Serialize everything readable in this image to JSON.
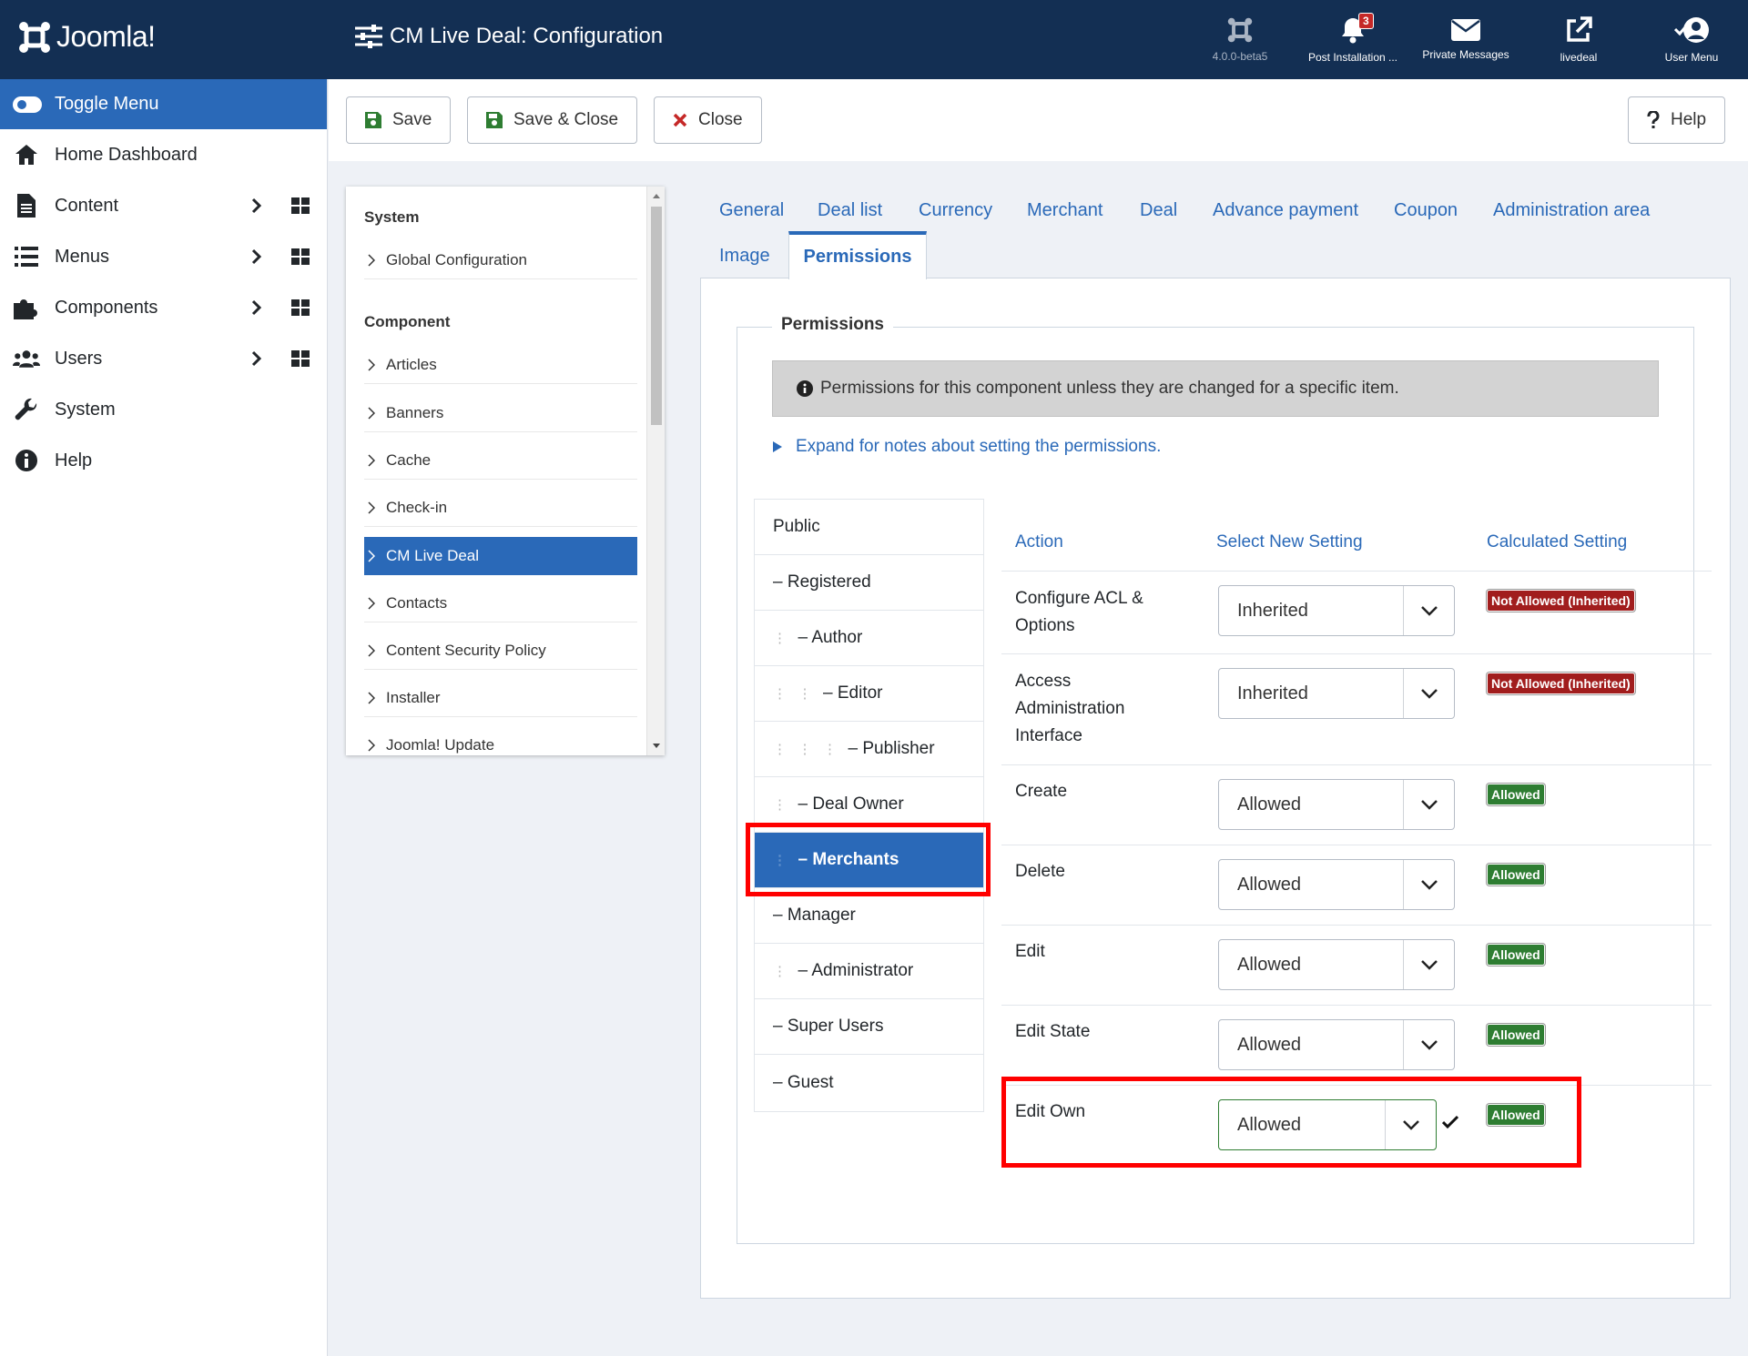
{
  "header": {
    "logo_text": "Joomla!",
    "title": "CM Live Deal: Configuration",
    "actions": [
      {
        "label": "4.0.0-beta5",
        "icon": "joomla-icon"
      },
      {
        "label": "Post Installation ...",
        "icon": "bell-icon",
        "badge": "3"
      },
      {
        "label": "Private Messages",
        "icon": "envelope-icon"
      },
      {
        "label": "livedeal",
        "icon": "external-link-icon"
      },
      {
        "label": "User Menu",
        "icon": "user-icon"
      }
    ]
  },
  "sidebar": {
    "toggle_label": "Toggle Menu",
    "items": [
      {
        "label": "Home Dashboard",
        "icon": "home-icon"
      },
      {
        "label": "Content",
        "icon": "file-icon"
      },
      {
        "label": "Menus",
        "icon": "list-icon"
      },
      {
        "label": "Components",
        "icon": "puzzle-icon"
      },
      {
        "label": "Users",
        "icon": "users-icon"
      },
      {
        "label": "System",
        "icon": "wrench-icon"
      },
      {
        "label": "Help",
        "icon": "info-icon"
      }
    ]
  },
  "toolbar": {
    "save": "Save",
    "save_close": "Save & Close",
    "close": "Close",
    "help": "Help"
  },
  "config_nav": {
    "system_heading": "System",
    "global": "Global Configuration",
    "component_heading": "Component",
    "items": [
      "Articles",
      "Banners",
      "Cache",
      "Check-in",
      "CM Live Deal",
      "Contacts",
      "Content Security Policy",
      "Installer",
      "Joomla! Update"
    ],
    "active": "CM Live Deal"
  },
  "tabs": [
    "General",
    "Deal list",
    "Currency",
    "Merchant",
    "Deal",
    "Advance payment",
    "Coupon",
    "Administration area",
    "Image",
    "Permissions"
  ],
  "permissions": {
    "legend": "Permissions",
    "alert": "Permissions for this component unless they are changed for a specific item.",
    "expand": "Expand for notes about setting the permissions.",
    "groups": [
      {
        "label": "Public"
      },
      {
        "label": "– Registered"
      },
      {
        "label": "– Author"
      },
      {
        "label": "– Editor"
      },
      {
        "label": "– Publisher"
      },
      {
        "label": "– Deal Owner"
      },
      {
        "label": "– Merchants"
      },
      {
        "label": "– Manager"
      },
      {
        "label": "– Administrator"
      },
      {
        "label": "– Super Users"
      },
      {
        "label": "– Guest"
      }
    ],
    "columns": {
      "action": "Action",
      "select": "Select New Setting",
      "calculated": "Calculated Setting"
    },
    "rows": [
      {
        "action": "Configure ACL & Options",
        "setting": "Inherited",
        "calculated": "Not Allowed (Inherited)"
      },
      {
        "action": "Access Administration Interface",
        "setting": "Inherited",
        "calculated": "Not Allowed (Inherited)"
      },
      {
        "action": "Create",
        "setting": "Allowed",
        "calculated": "Allowed"
      },
      {
        "action": "Delete",
        "setting": "Allowed",
        "calculated": "Allowed"
      },
      {
        "action": "Edit",
        "setting": "Allowed",
        "calculated": "Allowed"
      },
      {
        "action": "Edit State",
        "setting": "Allowed",
        "calculated": "Allowed"
      },
      {
        "action": "Edit Own",
        "setting": "Allowed",
        "calculated": "Allowed"
      }
    ]
  }
}
